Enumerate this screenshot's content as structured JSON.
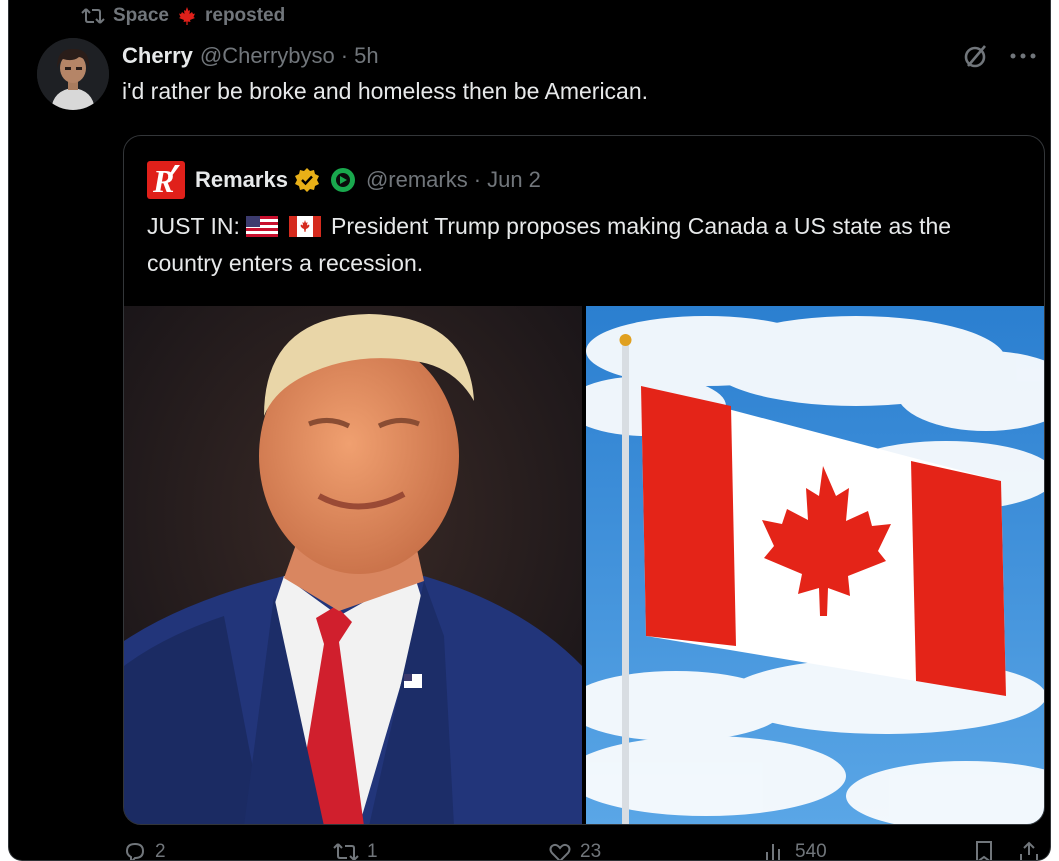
{
  "repost": {
    "user": "Space",
    "label": "reposted"
  },
  "post": {
    "author_name": "Cherry",
    "author_handle": "@Cherrybyso",
    "separator": "·",
    "time": "5h",
    "text": "i'd rather be broke and homeless then be American."
  },
  "quote": {
    "author_name": "Remarks",
    "author_handle": "@remarks",
    "separator": "·",
    "time": "Jun 2",
    "text_prefix": "JUST IN:",
    "text_body": "President Trump proposes making Canada a US state as the country enters a recession.",
    "inline_icons": [
      "us-flag-icon",
      "canada-flag-icon"
    ]
  },
  "actions": [
    {
      "icon": "reply-icon",
      "count": "2"
    },
    {
      "icon": "repost-icon",
      "count": "1"
    },
    {
      "icon": "like-icon",
      "count": "23"
    },
    {
      "icon": "views-icon",
      "count": "540"
    },
    {
      "icon": "bookmark-icon",
      "count": ""
    },
    {
      "icon": "share-icon",
      "count": ""
    }
  ],
  "colors": {
    "background": "#000000",
    "primary_text": "#e7e9ea",
    "secondary_text": "#71767b",
    "border": "#2f3336",
    "gold_badge": "#e8b017",
    "green_badge": "#19a84d",
    "remarks_red": "#e0201a"
  }
}
